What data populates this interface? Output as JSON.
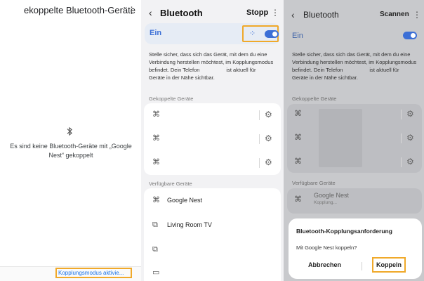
{
  "panel1": {
    "title": "ekoppelte Bluetooth-Geräte",
    "menu_glyph": "⋮",
    "empty_icon": "bluetooth-icon",
    "empty_text": "Es sind keine Bluetooth-Geräte mit „Google Nest“ gekoppelt",
    "pairing_link": "Kopplungsmodus aktivie..."
  },
  "panel2": {
    "back_glyph": "‹",
    "title": "Bluetooth",
    "action": "Stopp",
    "menu_glyph": "⋮",
    "switch_label": "Ein",
    "scan_glyph": "⁘",
    "info_line1": "Stelle sicher, dass sich das Gerät, mit dem du eine",
    "info_line2": "Verbindung herstellen möchtest, im Kopplungsmodus",
    "info_line3_a": "befindet. Dein Telefon",
    "info_line3_b": "ist aktuell für",
    "info_line4": "Geräte in der Nähe sichtbar.",
    "paired_section": "Gekoppelte Geräte",
    "available_section": "Verfügbare Geräte",
    "available_devices": [
      "Google Nest",
      "Living Room TV"
    ],
    "gear_glyph": "⚙",
    "device_glyph": "⌘",
    "cast_glyph": "⧉",
    "laptop_glyph": "▭"
  },
  "panel3": {
    "back_glyph": "‹",
    "title": "Bluetooth",
    "action": "Scannen",
    "menu_glyph": "⋮",
    "switch_label": "Ein",
    "info_line1": "Stelle sicher, dass sich das Gerät, mit dem du eine",
    "info_line2": "Verbindung herstellen möchtest, im Kopplungsmodus",
    "info_line3_a": "befindet. Dein Telefon",
    "info_line3_b": "ist aktuell für",
    "info_line4": "Geräte in der Nähe sichtbar.",
    "paired_section": "Gekoppelte Geräte",
    "available_section": "Verfügbare Geräte",
    "available_device": "Google Nest",
    "available_device_status": "Kopplung...",
    "gear_glyph": "⚙",
    "device_glyph": "⌘",
    "dialog": {
      "title": "Bluetooth-Kopplungsanforderung",
      "message": "Mit Google Nest koppeln?",
      "cancel": "Abbrechen",
      "confirm": "Koppeln"
    }
  },
  "colors": {
    "accent": "#3c6fd6",
    "highlight": "#f0a92a",
    "link": "#1a73e8"
  }
}
